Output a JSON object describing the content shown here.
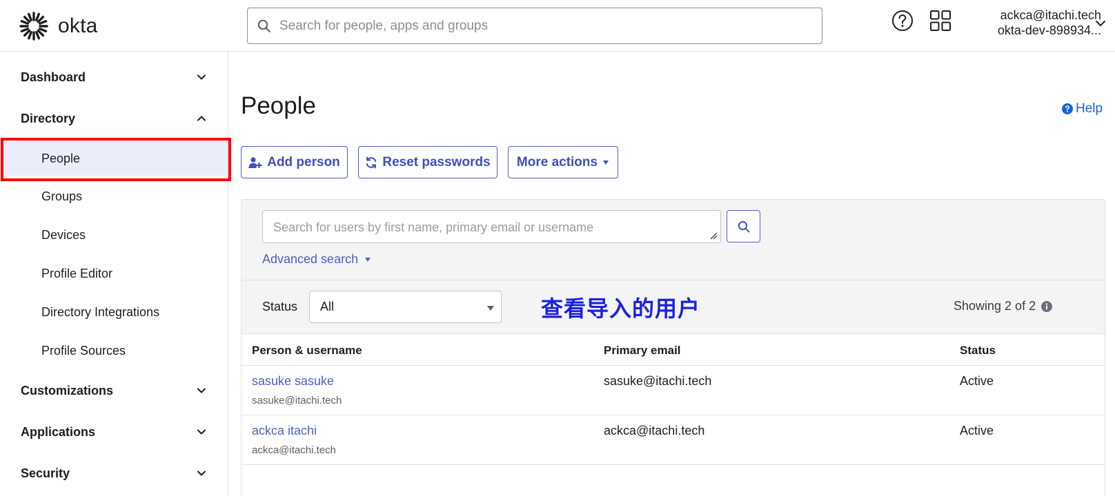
{
  "header": {
    "logo_text": "okta",
    "search_placeholder": "Search for people, apps and groups",
    "user_email": "ackca@itachi.tech",
    "org_name": "okta-dev-898934...",
    "icons": [
      "help-circle-icon",
      "app-grid-icon",
      "chevron-down-icon"
    ]
  },
  "sidebar": {
    "sections": [
      {
        "label": "Dashboard",
        "expanded": false
      },
      {
        "label": "Directory",
        "expanded": true,
        "items": [
          "People",
          "Groups",
          "Devices",
          "Profile Editor",
          "Directory Integrations",
          "Profile Sources"
        ],
        "active_item": "People"
      },
      {
        "label": "Customizations",
        "expanded": false
      },
      {
        "label": "Applications",
        "expanded": false
      },
      {
        "label": "Security",
        "expanded": false
      }
    ]
  },
  "main": {
    "title": "People",
    "help_label": "Help",
    "actions": {
      "add_person": "Add person",
      "reset_passwords": "Reset passwords",
      "more_actions": "More actions"
    },
    "search": {
      "placeholder": "Search for users by first name, primary email or username",
      "advanced_label": "Advanced search"
    },
    "filter": {
      "status_label": "Status",
      "status_value": "All",
      "showing_text": "Showing 2 of 2"
    },
    "annotation": "查看导入的用户",
    "table": {
      "columns": [
        "Person & username",
        "Primary email",
        "Status"
      ],
      "rows": [
        {
          "name": "sasuke sasuke",
          "username": "sasuke@itachi.tech",
          "email": "sasuke@itachi.tech",
          "status": "Active"
        },
        {
          "name": "ackca itachi",
          "username": "ackca@itachi.tech",
          "email": "ackca@itachi.tech",
          "status": "Active"
        }
      ]
    }
  },
  "colors": {
    "accent": "#4f5ec7",
    "active_nav_bg": "#ebedfb",
    "highlight_outline": "#ff0000",
    "annotation": "#1a22e0",
    "help_link": "#1662dd"
  }
}
